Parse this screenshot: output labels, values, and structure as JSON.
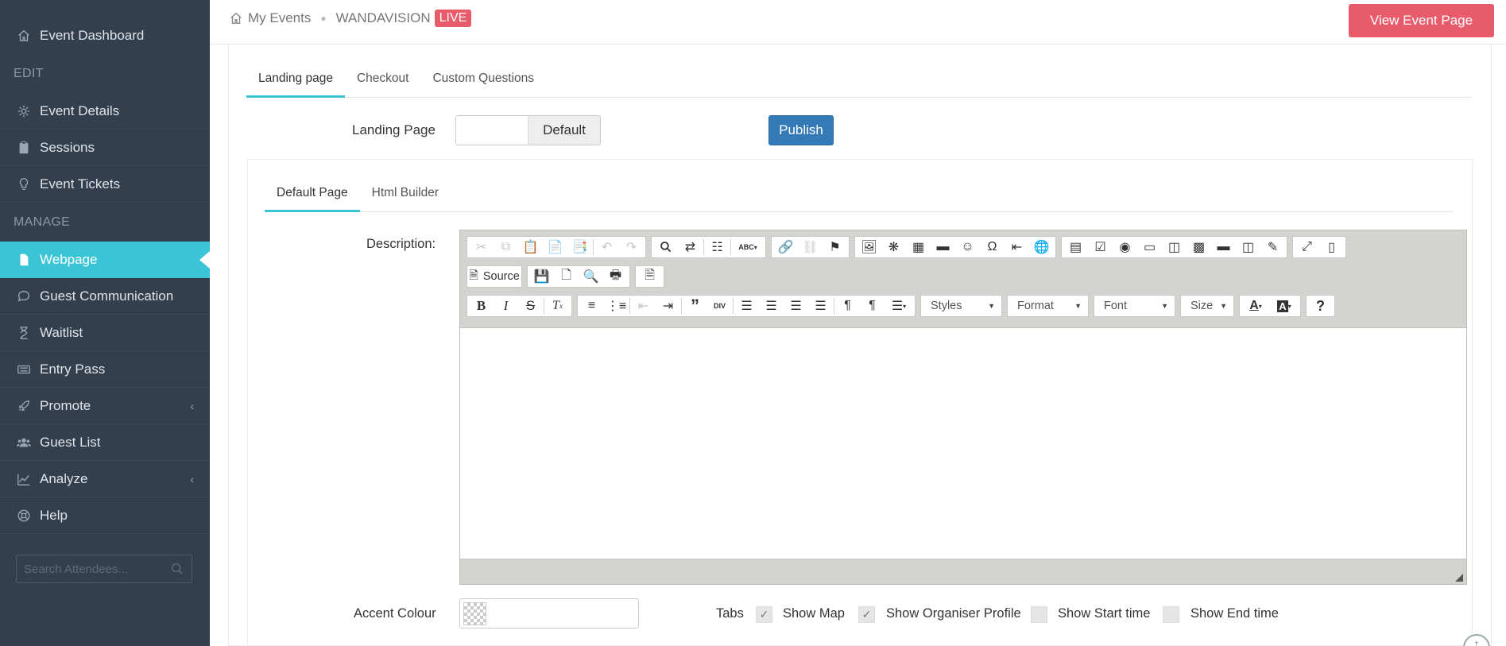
{
  "sidebar": {
    "event_dashboard": "Event Dashboard",
    "section_edit": "EDIT",
    "event_details": "Event Details",
    "sessions": "Sessions",
    "event_tickets": "Event Tickets",
    "section_manage": "MANAGE",
    "webpage": "Webpage",
    "guest_communication": "Guest Communication",
    "waitlist": "Waitlist",
    "entry_pass": "Entry Pass",
    "promote": "Promote",
    "guest_list": "Guest List",
    "analyze": "Analyze",
    "help": "Help",
    "search_placeholder": "Search Attendees...",
    "active_color": "#3bc4d6",
    "background_color": "#343f4d"
  },
  "topbar": {
    "my_events": "My Events",
    "event_name": "WANDAVISION",
    "live_badge": "LIVE",
    "view_event_page": "View Event Page"
  },
  "main": {
    "tabs": [
      "Landing page",
      "Checkout",
      "Custom Questions"
    ],
    "active_tab": "Landing page",
    "landing_page_label": "Landing Page",
    "landing_page_toggle": "Default",
    "publish": "Publish",
    "sub_tabs": [
      "Default Page",
      "Html Builder"
    ],
    "active_sub_tab": "Default Page",
    "description_label": "Description:",
    "editor": {
      "source": "Source",
      "styles": "Styles",
      "format": "Format",
      "font": "Font",
      "size": "Size",
      "help": "?"
    },
    "accent_colour_label": "Accent Colour",
    "tabs_label": "Tabs",
    "options": [
      {
        "label": "Show Map",
        "checked": true
      },
      {
        "label": "Show Organiser Profile",
        "checked": true
      },
      {
        "label": "Show Start time",
        "checked": false
      },
      {
        "label": "Show End time",
        "checked": false
      }
    ]
  }
}
